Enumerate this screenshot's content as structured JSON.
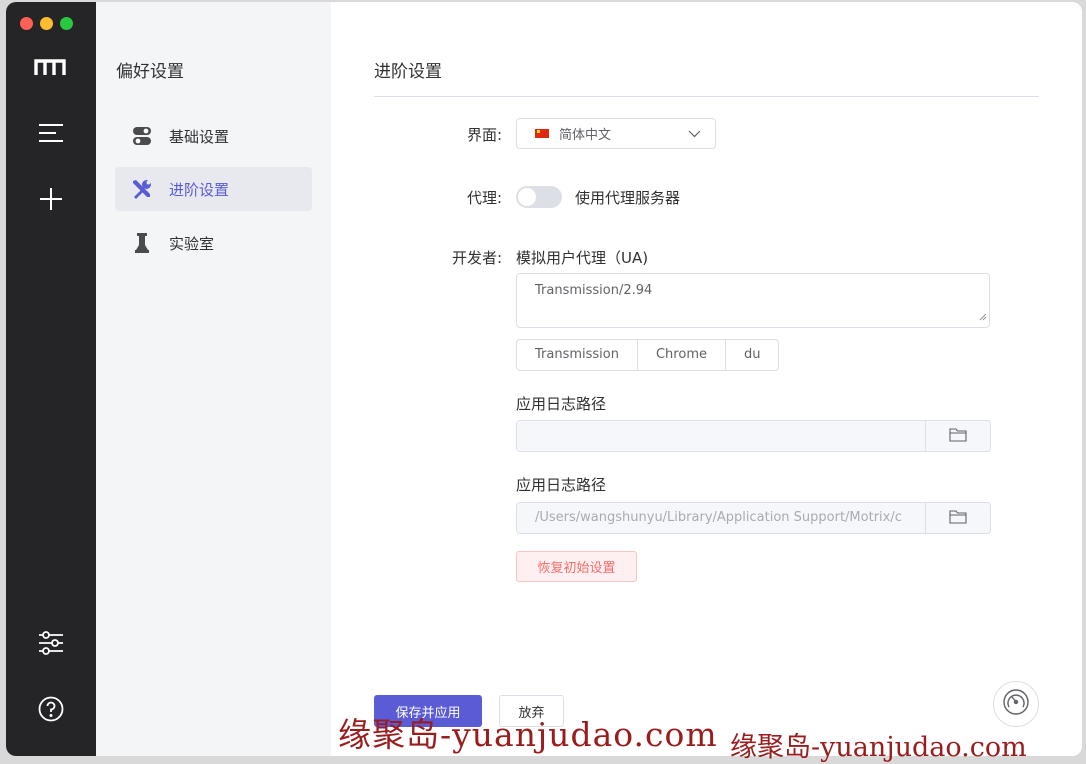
{
  "sidebar": {
    "icons": [
      "logo-icon",
      "menu-icon",
      "plus-icon",
      "preferences-icon",
      "help-icon"
    ]
  },
  "subnav": {
    "title": "偏好设置",
    "items": [
      {
        "label": "基础设置",
        "icon": "toggle-icon"
      },
      {
        "label": "进阶设置",
        "icon": "tools-icon",
        "active": true
      },
      {
        "label": "实验室",
        "icon": "lab-icon"
      }
    ]
  },
  "main": {
    "title": "进阶设置",
    "language": {
      "label": "界面:",
      "value": "简体中文"
    },
    "proxy": {
      "label": "代理:",
      "switch_text": "使用代理服务器",
      "enabled": false
    },
    "developer": {
      "label": "开发者:",
      "ua_label": "模拟用户代理（UA)",
      "ua_value": "Transmission/2.94",
      "ua_presets": [
        "Transmission",
        "Chrome",
        "du"
      ],
      "log_label_1": "应用日志路径",
      "log_value_1": "",
      "log_label_2": "应用日志路径",
      "log_value_2": "/Users/wangshunyu/Library/Application Support/Motrix/c",
      "reset_label": "恢复初始设置"
    },
    "footer": {
      "save_label": "保存并应用",
      "cancel_label": "放弃"
    }
  },
  "watermark": {
    "text1": "缘聚岛-yuanjudao.com",
    "text2": "缘聚岛-yuanjudao.com"
  },
  "colors": {
    "accent": "#5b5bd6",
    "sidebar_bg": "#252426",
    "danger": "#f56c6c"
  }
}
